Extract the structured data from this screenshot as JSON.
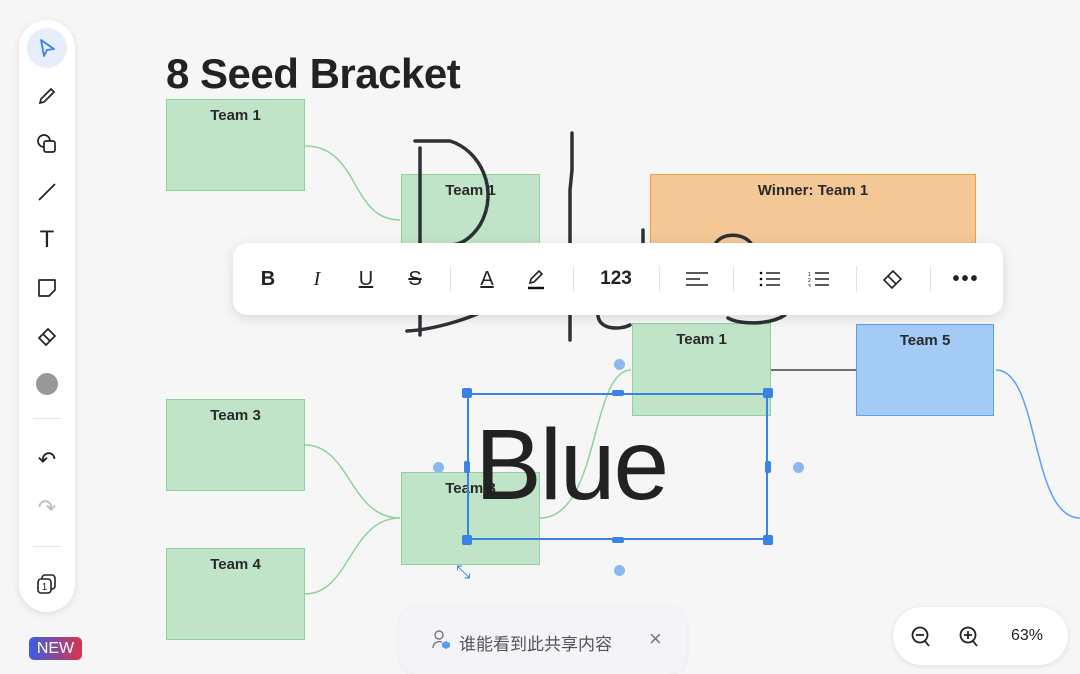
{
  "board": {
    "title": "8 Seed Bracket",
    "boxes": {
      "r1_team1": "Team 1",
      "r2_team1": "Team 1",
      "winner": "Winner: Team 1",
      "r3_team1": "Team 1",
      "team5": "Team 5",
      "team3": "Team 3",
      "team4": "Team 4",
      "r2_team3": "Team 3"
    },
    "selected_text": "Blue"
  },
  "left_toolbar": {
    "tools": [
      "select-icon",
      "pencil-icon",
      "shapes-icon",
      "line-icon",
      "text-icon",
      "sticky-note-icon",
      "eraser-icon",
      "color-icon",
      "undo-icon",
      "redo-icon",
      "pages-icon"
    ],
    "new_badge": "NEW",
    "color": "#999999"
  },
  "format_toolbar": {
    "bold": "B",
    "italic": "I",
    "underline": "U",
    "strikethrough": "S",
    "font_color": "A",
    "number_label": "123"
  },
  "share_banner": {
    "text": "谁能看到此共享内容",
    "close": "×"
  },
  "zoom": {
    "level": "63%"
  },
  "colors": {
    "accent": "#3b82e6",
    "green_box": "#c0e4c8",
    "orange_box": "#f3c896",
    "blue_box": "#a3cbf5"
  }
}
